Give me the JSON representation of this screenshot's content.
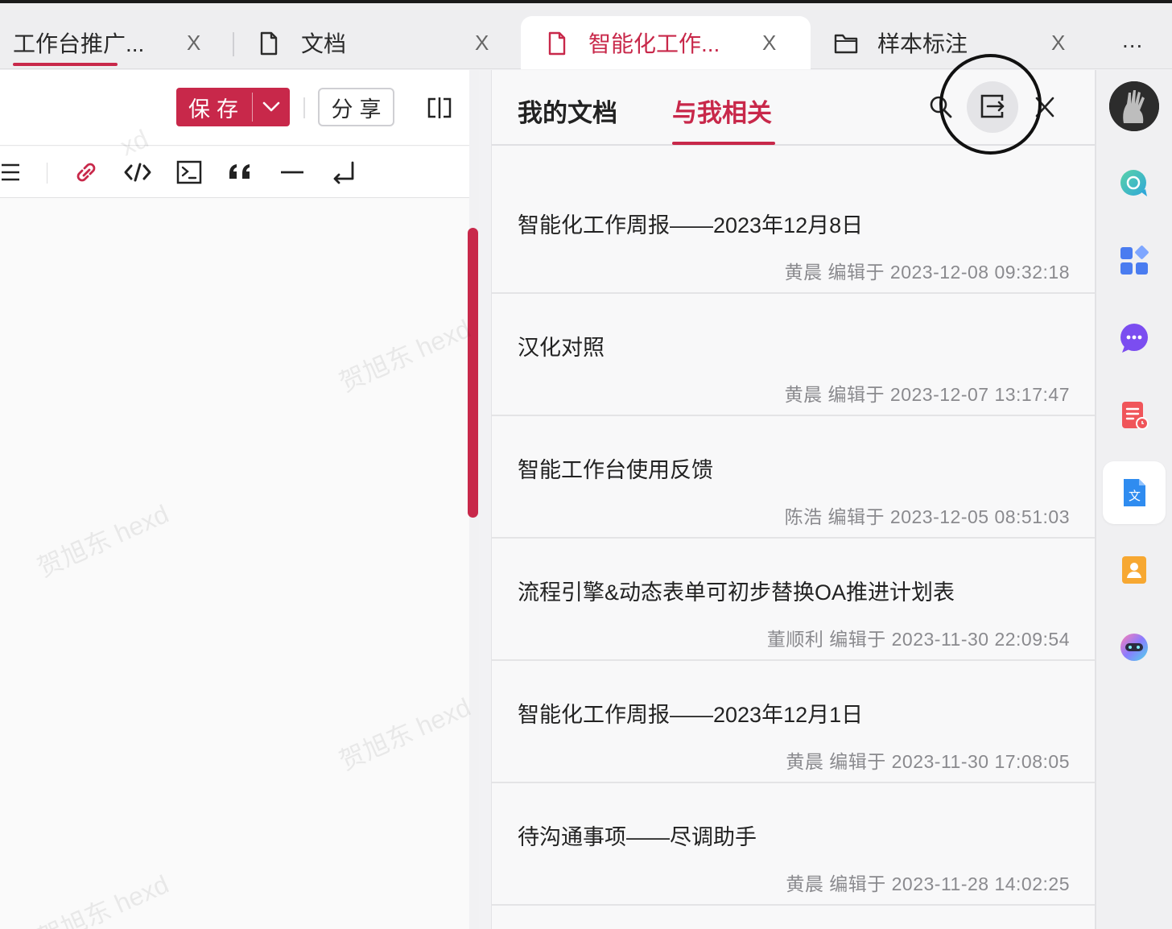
{
  "tabs": [
    {
      "label": "工作台推广...",
      "icon": "none",
      "active": false
    },
    {
      "label": "文档",
      "icon": "document-icon",
      "active": false
    },
    {
      "label": "智能化工作...",
      "icon": "document-icon",
      "active": true
    },
    {
      "label": "样本标注",
      "icon": "folder-icon",
      "active": false
    }
  ],
  "tab_close_label": "X",
  "tab_more_label": "...",
  "editor": {
    "save_label": "保存",
    "share_label": "分享",
    "watermark": "贺旭东 hexd",
    "watermark_partial": "xd"
  },
  "panel": {
    "tabs": [
      {
        "label": "我的文档",
        "active": false
      },
      {
        "label": "与我相关",
        "active": true
      }
    ],
    "documents": [
      {
        "title": "智能化工作周报——2023年12月8日",
        "meta": "黄晨 编辑于 2023-12-08 09:32:18"
      },
      {
        "title": "汉化对照",
        "meta": "黄晨 编辑于 2023-12-07 13:17:47"
      },
      {
        "title": "智能工作台使用反馈",
        "meta": "陈浩 编辑于 2023-12-05 08:51:03"
      },
      {
        "title": "流程引擎&动态表单可初步替换OA推进计划表",
        "meta": "董顺利 编辑于 2023-11-30 22:09:54"
      },
      {
        "title": "智能化工作周报——2023年12月1日",
        "meta": "黄晨 编辑于 2023-11-30 17:08:05"
      },
      {
        "title": "待沟通事项——尽调助手",
        "meta": "黄晨 编辑于 2023-11-28 14:02:25"
      }
    ]
  },
  "rail": {
    "items": [
      "avatar",
      "search-chat-icon",
      "apps-grid-icon",
      "message-bubble-icon",
      "schedule-doc-icon",
      "translate-doc-icon",
      "contacts-icon",
      "ai-bot-icon"
    ],
    "active": "translate-doc-icon"
  },
  "colors": {
    "accent": "#c8284a",
    "text": "#222222",
    "meta_text": "#8a8a8e",
    "tabbar_bg": "#eeeef0",
    "panel_bg": "#f8f8f9"
  }
}
